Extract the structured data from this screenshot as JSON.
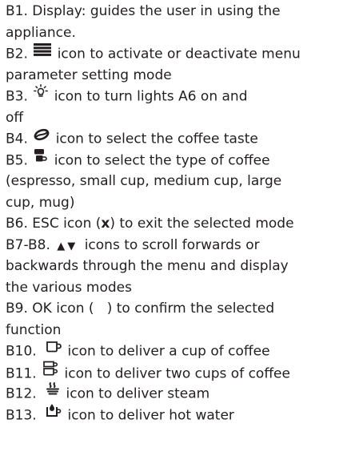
{
  "items": {
    "b1": [
      "B1. Display: guides the user in using the",
      "appliance."
    ],
    "b2": {
      "prefix": "B2.",
      "icon": "menu-icon",
      "text1": "icon to activate or deactivate menu",
      "text2": "parameter setting mode"
    },
    "b3": {
      "prefix": "B3.",
      "icon": "light-bulb-icon",
      "text1": "icon to turn lights A6 on and",
      "text2": "off"
    },
    "b4": {
      "prefix": "B4.",
      "icon": "coffee-bean-icon",
      "text1": "icon to select the coffee taste"
    },
    "b5": {
      "prefix": "B5.",
      "icon": "coffee-type-icon",
      "text1": "icon to select the type of coffee",
      "text2": "(espresso, small cup, medium cup, large",
      "text3": "cup, mug)"
    },
    "b6": {
      "pre": "B6. ESC icon (",
      "bold": "x",
      "post": ") to exit the selected mode"
    },
    "b78": {
      "prefix": "B7-B8.",
      "arrows": "▲▼",
      "text1": "icons to scroll forwards or",
      "text2": "backwards through the menu and display",
      "text3": "the various modes"
    },
    "b9": [
      "B9. OK icon (   ) to confirm the selected",
      "function"
    ],
    "b10": {
      "prefix": "B10.",
      "icon": "one-cup-icon",
      "text": "icon to deliver a cup of coffee"
    },
    "b11": {
      "prefix": "B11.",
      "icon": "two-cups-icon",
      "text": "icon to deliver two cups of coffee"
    },
    "b12": {
      "prefix": "B12.",
      "icon": "steam-icon",
      "text": "icon to deliver steam"
    },
    "b13": {
      "prefix": "B13.",
      "icon": "hot-water-icon",
      "text": "icon to deliver hot water"
    }
  },
  "colors": {
    "text": "#231f20",
    "background": "#ffffff"
  }
}
